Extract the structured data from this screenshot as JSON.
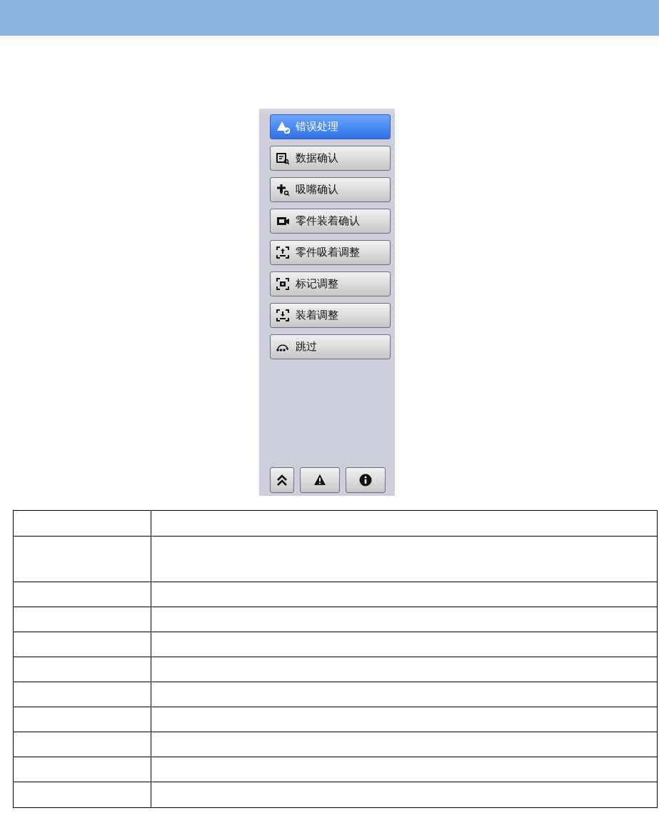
{
  "menu": [
    {
      "label": "错误处理",
      "selected": true,
      "kind": "error"
    },
    {
      "label": "数据确认",
      "selected": false,
      "kind": "data"
    },
    {
      "label": "吸嘴确认",
      "selected": false,
      "kind": "nozzle"
    },
    {
      "label": "零件装着确认",
      "selected": false,
      "kind": "camera"
    },
    {
      "label": "零件吸着调整",
      "selected": false,
      "kind": "pickup"
    },
    {
      "label": "标记调整",
      "selected": false,
      "kind": "mark"
    },
    {
      "label": "装着调整",
      "selected": false,
      "kind": "place"
    },
    {
      "label": "跳过",
      "selected": false,
      "kind": "skip"
    }
  ],
  "footer_buttons": [
    {
      "kind": "collapse"
    },
    {
      "kind": "warning"
    },
    {
      "kind": "info"
    }
  ]
}
